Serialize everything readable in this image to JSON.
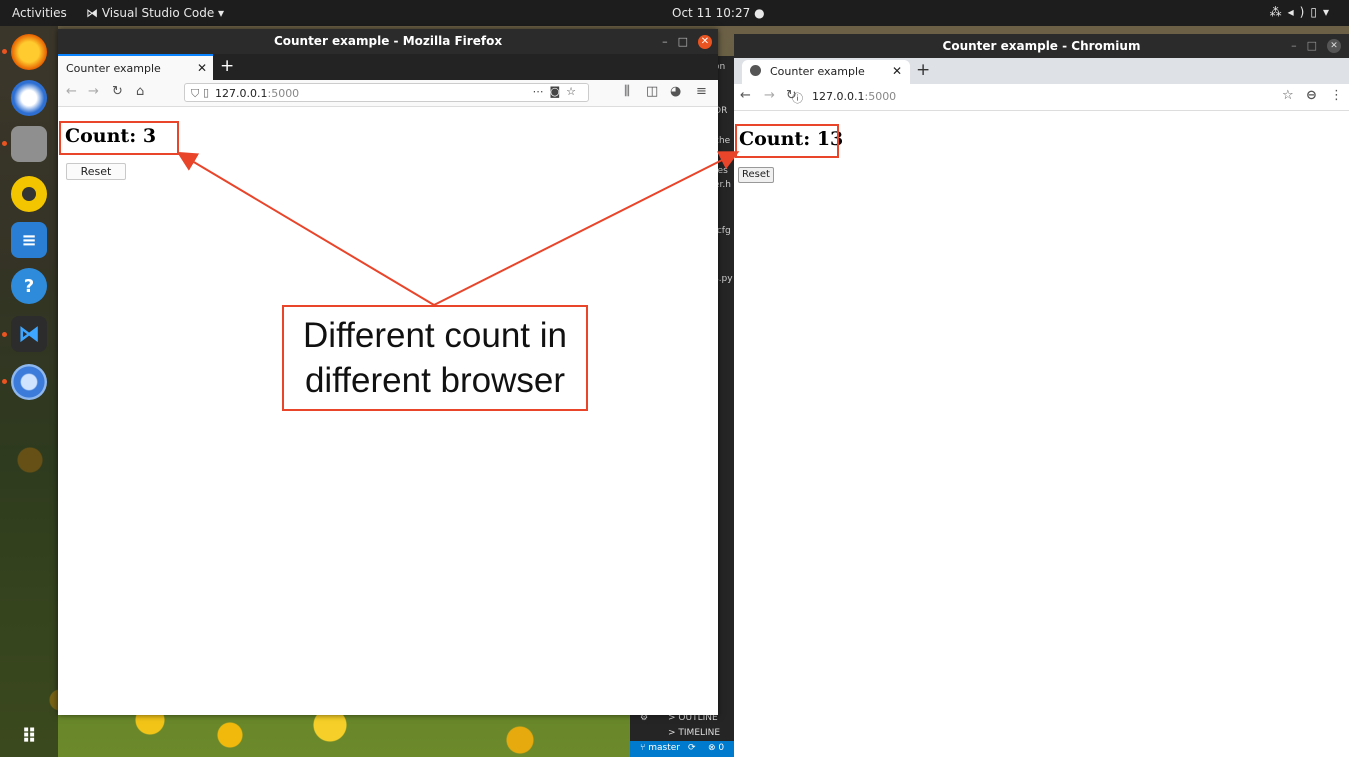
{
  "topbar": {
    "activities": "Activities",
    "app_name": "Visual Studio Code",
    "clock": "Oct 11 10:27"
  },
  "dock": {
    "icons": [
      "firefox-icon",
      "thunderbird-icon",
      "files-icon",
      "rhythmbox-icon",
      "writer-icon",
      "help-icon",
      "vscode-icon",
      "chromium-icon",
      "show-apps-icon"
    ]
  },
  "vscode": {
    "outline": "OUTLINE",
    "timeline": "TIMELINE",
    "branch": "master",
    "status": "⊗ 0"
  },
  "firefox": {
    "window_title": "Counter example - Mozilla Firefox",
    "tab_label": "Counter example",
    "url_host": "127.0.0.1",
    "url_port": ":5000",
    "count_text": "Count: 3",
    "reset_label": "Reset"
  },
  "chromium": {
    "window_title": "Counter example - Chromium",
    "tab_label": "Counter example",
    "url_host": "127.0.0.1",
    "url_port": ":5000",
    "count_text": "Count: 13",
    "reset_label": "Reset"
  },
  "annotation": {
    "line1": "Different count in",
    "line2": "different browser",
    "color": "#e8452b"
  }
}
